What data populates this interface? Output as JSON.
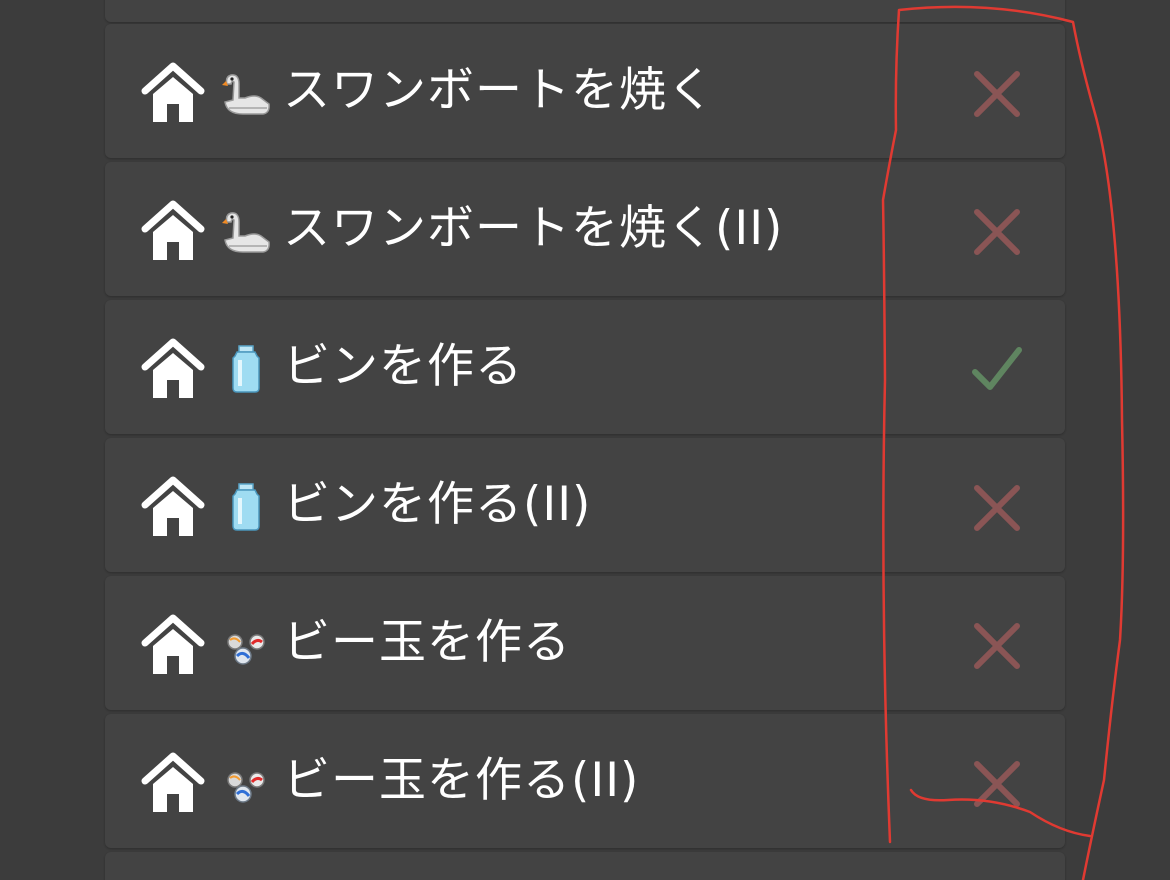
{
  "colors": {
    "background": "#3c3c3c",
    "card": "#434343",
    "text": "#ffffff",
    "incomplete": "#8a5555",
    "complete": "#5f8560",
    "annotation": "#e03a32"
  },
  "tasks": [
    {
      "label": "スワンボートを焼く",
      "item_icon": "swan-boat-icon",
      "status": "incomplete",
      "status_icon": "cross-icon"
    },
    {
      "label": "スワンボートを焼く(II)",
      "item_icon": "swan-boat-icon",
      "status": "incomplete",
      "status_icon": "cross-icon"
    },
    {
      "label": "ビンを作る",
      "item_icon": "bottle-icon",
      "status": "complete",
      "status_icon": "check-icon"
    },
    {
      "label": "ビンを作る(II)",
      "item_icon": "bottle-icon",
      "status": "incomplete",
      "status_icon": "cross-icon"
    },
    {
      "label": "ビー玉を作る",
      "item_icon": "marbles-icon",
      "status": "incomplete",
      "status_icon": "cross-icon"
    },
    {
      "label": "ビー玉を作る(II)",
      "item_icon": "marbles-icon",
      "status": "incomplete",
      "status_icon": "cross-icon"
    }
  ]
}
